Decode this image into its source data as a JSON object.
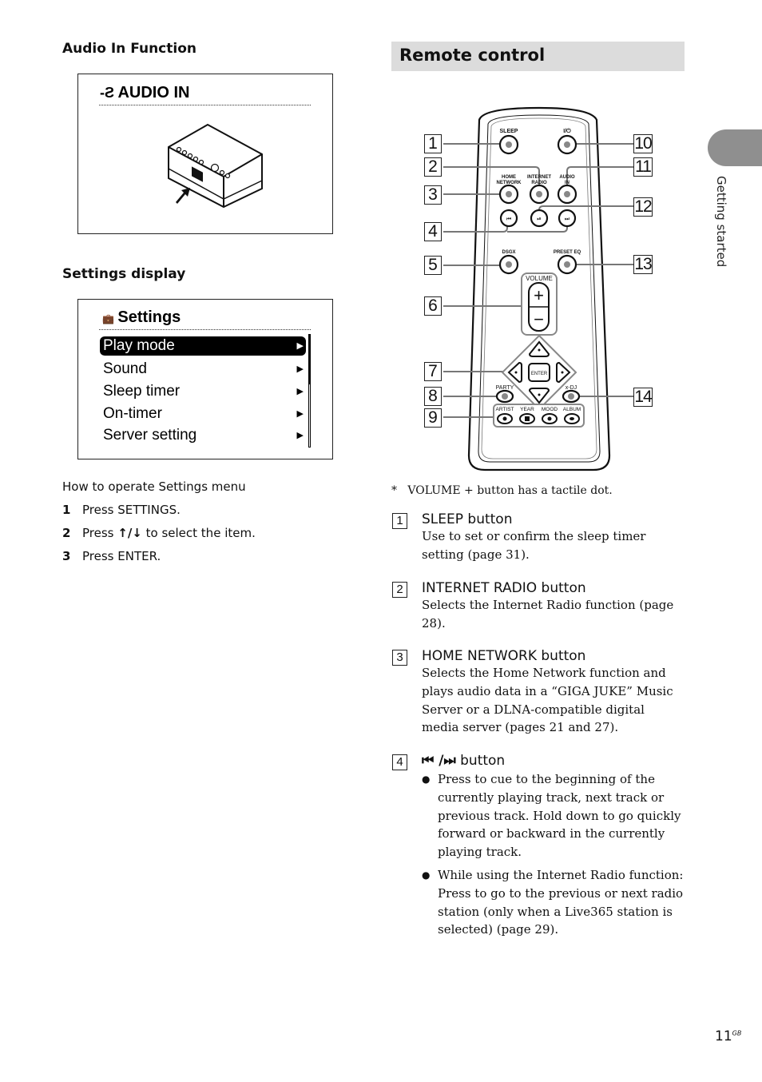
{
  "left": {
    "audio_in_heading": "Audio In Function",
    "audio_in_display": {
      "icon": "audio-in-plug-icon",
      "title": "AUDIO IN"
    },
    "settings_heading": "Settings display",
    "settings_display": {
      "icon": "settings-toolbox-icon",
      "title": "Settings",
      "items": [
        {
          "label": "Play mode",
          "selected": true
        },
        {
          "label": "Sound",
          "selected": false
        },
        {
          "label": "Sleep timer",
          "selected": false
        },
        {
          "label": "On-timer",
          "selected": false
        },
        {
          "label": "Server setting",
          "selected": false
        }
      ]
    },
    "howto_title": "How to operate Settings menu",
    "steps": [
      {
        "num": "1",
        "text": "Press SETTINGS."
      },
      {
        "num": "2",
        "pre": "Press ",
        "arrows": "↑/↓",
        "post": " to select the item."
      },
      {
        "num": "3",
        "text": "Press ENTER."
      }
    ]
  },
  "right": {
    "section_title": "Remote control",
    "remote": {
      "labels": {
        "sleep": "SLEEP",
        "power": "I/⏻",
        "home_network_1": "HOME",
        "home_network_2": "NETWORK",
        "internet_radio_1": "INTERNET",
        "internet_radio_2": "RADIO",
        "audio_in_1": "AUDIO",
        "audio_in_2": "IN",
        "dsgx": "DSGX",
        "preset_eq": "PRESET EQ",
        "volume": "VOLUME",
        "enter": "ENTER",
        "party": "PARTY",
        "xdj": "x-DJ",
        "artist": "ARTIST",
        "year": "YEAR",
        "mood": "MOOD",
        "album": "ALBUM"
      },
      "callouts": [
        "1",
        "2",
        "3",
        "4",
        "5",
        "6",
        "7",
        "8",
        "9",
        "10",
        "11",
        "12",
        "13",
        "14"
      ]
    },
    "footnote": "*   VOLUME + button has a tactile dot.",
    "items": [
      {
        "num": "1",
        "title": "SLEEP button",
        "body": "Use to set or confirm the sleep timer setting (page 31)."
      },
      {
        "num": "2",
        "title": "INTERNET RADIO button",
        "body": "Selects the Internet Radio function (page 28)."
      },
      {
        "num": "3",
        "title": "HOME NETWORK button",
        "body": "Selects the Home Network function and plays audio data in a “GIGA JUKE” Music Server or a DLNA-compatible digital media server (pages 21 and 27)."
      },
      {
        "num": "4",
        "title_icons": "⏮ /⏭",
        "title": " button",
        "bullets": [
          "Press to cue to the beginning of the currently playing track, next track or previous track. Hold down to go quickly forward or backward in the currently playing track.",
          "While using the Internet Radio function: Press to go to the previous or next radio station (only when a Live365 station is selected) (page 29)."
        ]
      }
    ]
  },
  "side_tab": {
    "label": "Getting started",
    "color": "#8f8f8f"
  },
  "page": {
    "number": "11",
    "suffix": "GB"
  }
}
